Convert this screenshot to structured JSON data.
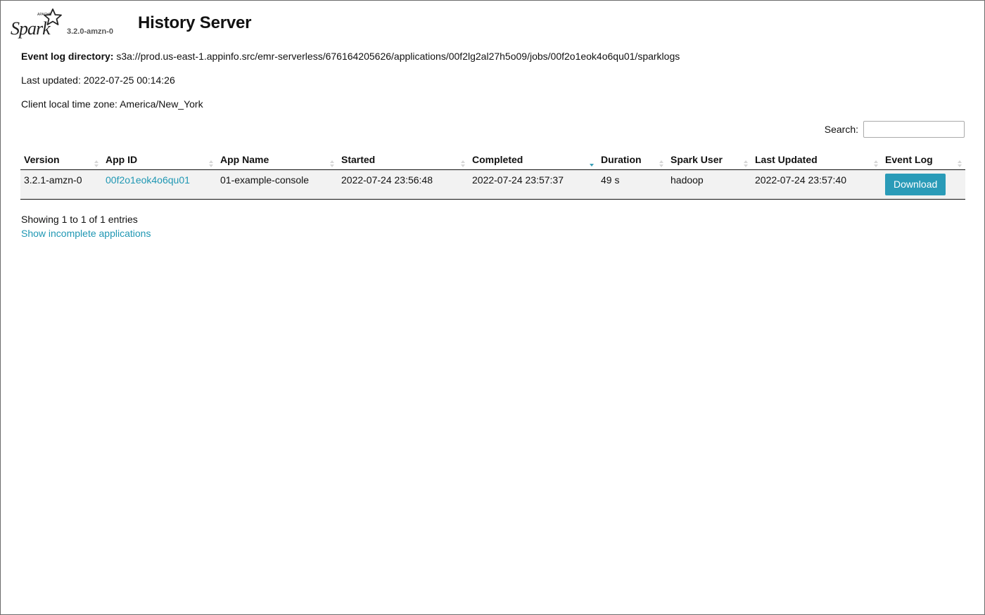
{
  "header": {
    "logo_text": "Spark",
    "logo_small_text": "APACHE",
    "version": "3.2.0-amzn-0",
    "title": "History Server"
  },
  "meta": {
    "event_log_label": "Event log directory:",
    "event_log_value": "s3a://prod.us-east-1.appinfo.src/emr-serverless/676164205626/applications/00f2lg2al27h5o09/jobs/00f2o1eok4o6qu01/sparklogs",
    "last_updated": "Last updated: 2022-07-25 00:14:26",
    "time_zone": "Client local time zone: America/New_York"
  },
  "search": {
    "label": "Search:",
    "value": "",
    "placeholder": ""
  },
  "table": {
    "columns": [
      "Version",
      "App ID",
      "App Name",
      "Started",
      "Completed",
      "Duration",
      "Spark User",
      "Last Updated",
      "Event Log"
    ],
    "sorted_column": "Completed",
    "sort_direction": "descending",
    "rows": [
      {
        "version": "3.2.1-amzn-0",
        "app_id": "00f2o1eok4o6qu01",
        "app_name": "01-example-console",
        "started": "2022-07-24 23:56:48",
        "completed": "2022-07-24 23:57:37",
        "duration": "49 s",
        "spark_user": "hadoop",
        "last_updated": "2022-07-24 23:57:40",
        "event_log": "Download"
      }
    ]
  },
  "footer": {
    "entries": "Showing 1 to 1 of 1 entries",
    "incomplete_link": "Show incomplete applications"
  },
  "colors": {
    "accent": "#2a9bb8",
    "link": "#1f97b3",
    "row_bg": "#f2f2f2"
  },
  "icons": [
    "spark-logo-star-icon",
    "sort-both-icon",
    "sort-desc-icon"
  ]
}
